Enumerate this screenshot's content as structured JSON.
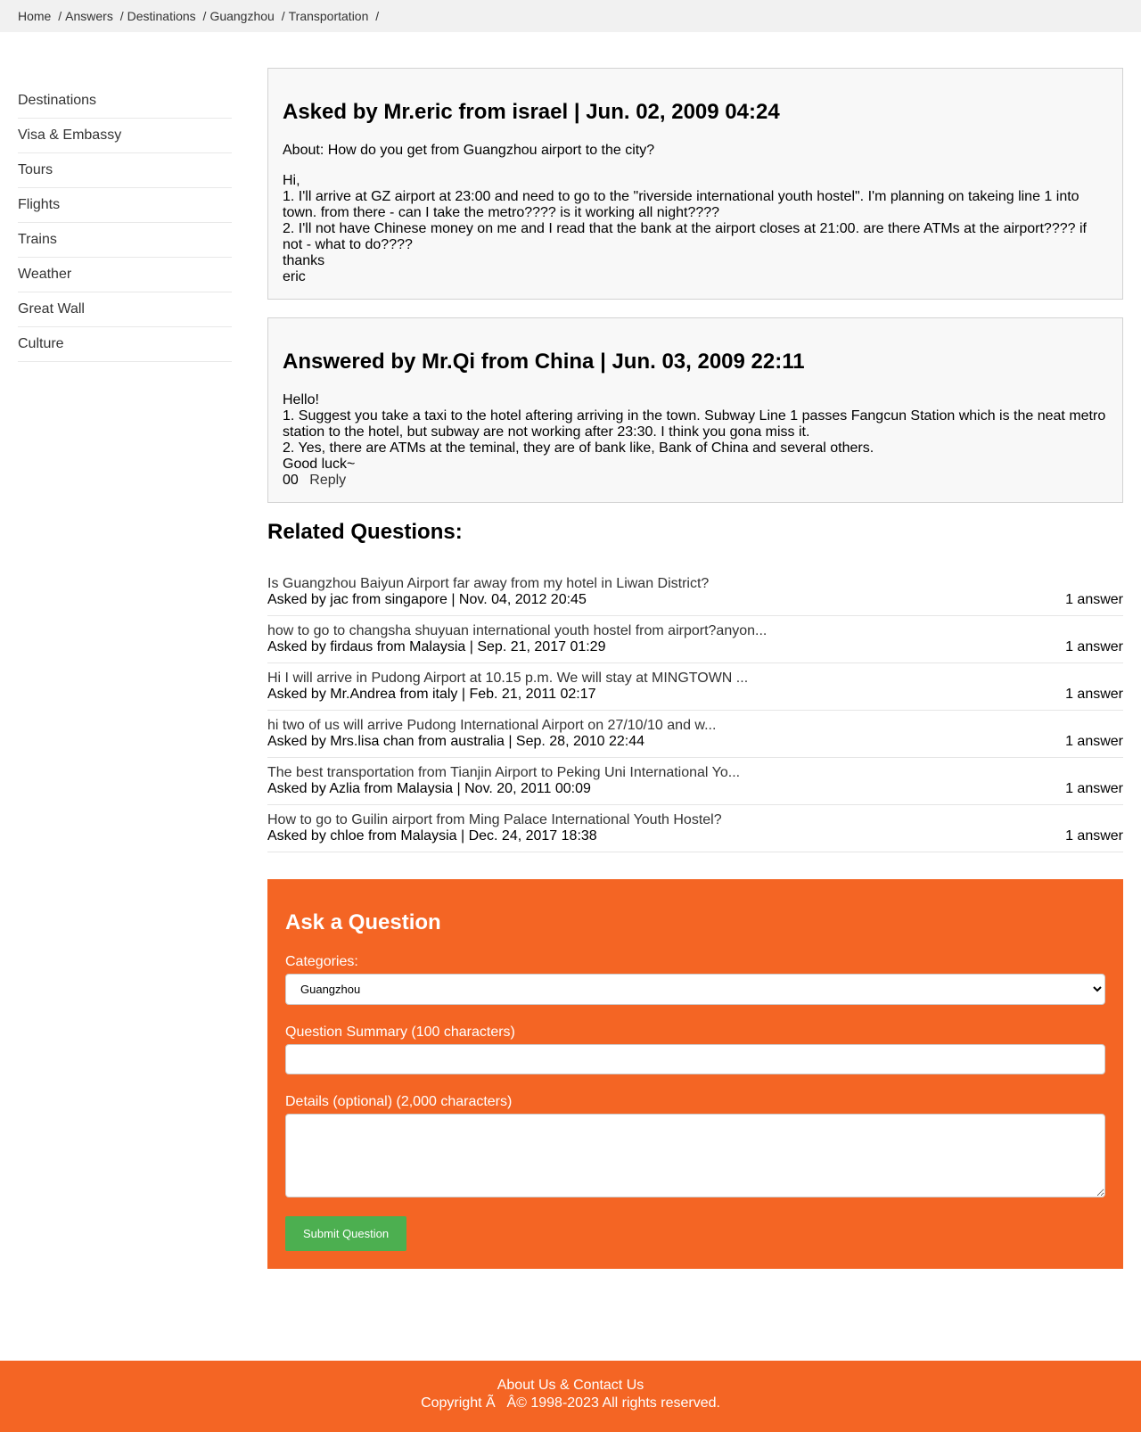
{
  "breadcrumb": {
    "items": [
      "Home",
      "Answers",
      "Destinations",
      "Guangzhou",
      "Transportation"
    ],
    "separator": "/"
  },
  "sidebar": {
    "items": [
      {
        "label": "Destinations"
      },
      {
        "label": "Visa & Embassy"
      },
      {
        "label": "Tours"
      },
      {
        "label": "Flights"
      },
      {
        "label": "Trains"
      },
      {
        "label": "Weather"
      },
      {
        "label": "Great Wall"
      },
      {
        "label": "Culture"
      }
    ]
  },
  "question": {
    "heading": "Asked by Mr.eric from israel | Jun. 02, 2009 04:24",
    "about": "About: How do you get from Guangzhou airport to the city?",
    "lines": [
      "Hi,",
      "1. I'll arrive at GZ airport at 23:00 and need to go to the \"riverside international youth hostel\". I'm planning on takeing line 1 into town. from there - can I take the metro???? is it working all night????",
      "2. I'll not have Chinese money on me and I read that the bank at the airport closes at 21:00. are there ATMs at the airport???? if not - what to do????",
      "thanks",
      "eric"
    ]
  },
  "answer": {
    "heading": "Answered by Mr.Qi from China | Jun. 03, 2009 22:11",
    "lines": [
      "Hello!",
      "1. Suggest you take a taxi to the hotel aftering arriving in the town. Subway Line 1 passes Fangcun Station which is the neat metro station to the hotel, but subway are not working after 23:30. I think you gona miss it.",
      "2. Yes, there are ATMs at the teminal, they are of bank like, Bank of China and several others.",
      "Good luck~"
    ],
    "votes_up": "0",
    "votes_down": "0",
    "reply_label": "Reply"
  },
  "related": {
    "title": "Related Questions:",
    "items": [
      {
        "question": "Is Guangzhou Baiyun Airport far away from my hotel in Liwan District?",
        "meta": "Asked by jac from singapore | Nov. 04, 2012 20:45",
        "count": "1 answer"
      },
      {
        "question": "how to go to changsha shuyuan international youth hostel from airport?anyon...",
        "meta": "Asked by firdaus from Malaysia | Sep. 21, 2017 01:29",
        "count": "1 answer"
      },
      {
        "question": "Hi I will arrive in Pudong Airport at 10.15 p.m. We will stay at MINGTOWN ...",
        "meta": "Asked by Mr.Andrea from italy | Feb. 21, 2011 02:17",
        "count": "1 answer"
      },
      {
        "question": "hi two of us will arrive Pudong International Airport on 27/10/10 and w...",
        "meta": "Asked by Mrs.lisa chan from australia | Sep. 28, 2010 22:44",
        "count": "1 answer"
      },
      {
        "question": "The best transportation from Tianjin Airport to Peking Uni International Yo...",
        "meta": "Asked by Azlia from Malaysia | Nov. 20, 2011 00:09",
        "count": "1 answer"
      },
      {
        "question": "How to go to Guilin airport from Ming Palace International Youth Hostel?",
        "meta": "Asked by chloe from Malaysia | Dec. 24, 2017 18:38",
        "count": "1 answer"
      }
    ]
  },
  "ask_form": {
    "title": "Ask a Question",
    "categories_label": "Categories:",
    "categories_selected": "Guangzhou",
    "summary_label": "Question Summary (100 characters)",
    "summary_value": "",
    "details_label": "Details (optional) (2,000 characters)",
    "details_value": "",
    "submit_label": "Submit Question"
  },
  "footer": {
    "about_link": "About Us & Contact Us",
    "copyright": "Copyright ÃÂ© 1998-2023 All rights reserved."
  },
  "colors": {
    "accent": "#f46524",
    "submit": "#4caf50",
    "breadcrumb_bg": "#f1f1f1",
    "box_bg": "#f8f8f8"
  }
}
